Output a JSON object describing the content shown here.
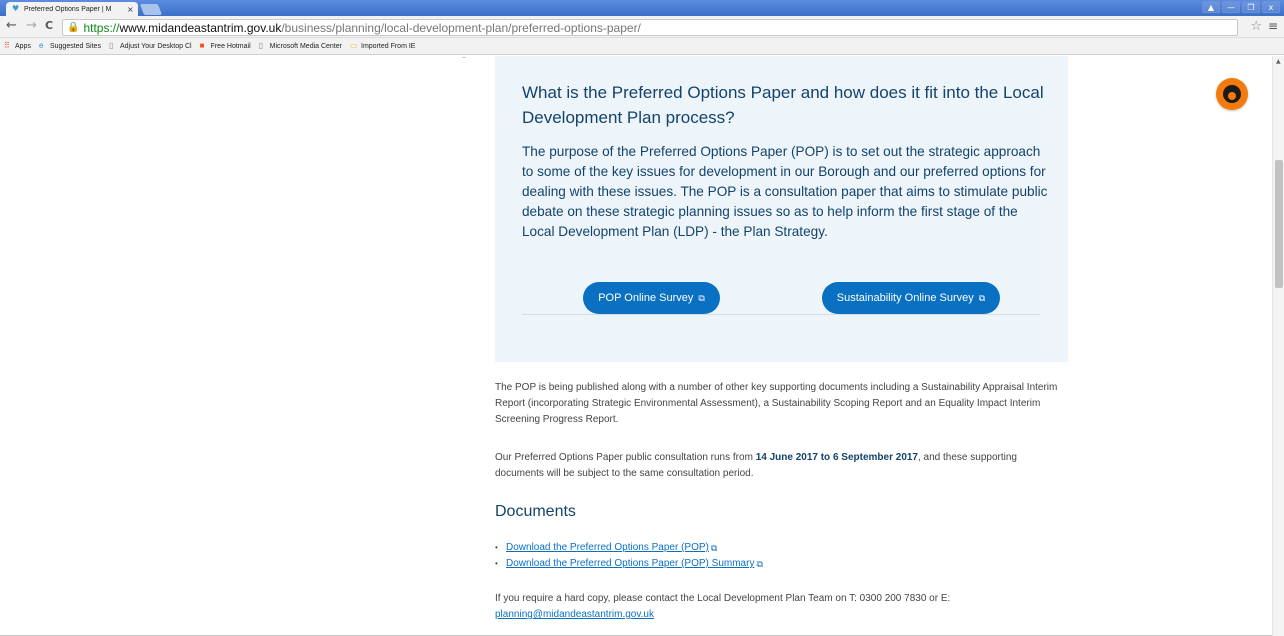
{
  "browser": {
    "tab_title": "Preferred Options Paper | M",
    "tab_close": "×",
    "window_controls": [
      "▲",
      "—",
      "❐",
      "x"
    ],
    "url_scheme": "https://",
    "url_host": "www.midandeastantrim.gov.uk",
    "url_path": "/business/planning/local-development-plan/preferred-options-paper/",
    "nav_back": "←",
    "nav_forward": "→",
    "nav_reload": "C",
    "star": "☆",
    "menu": "≡",
    "bookmarks": [
      {
        "label": "Apps",
        "icon": "apps-grid-icon"
      },
      {
        "label": "Suggested Sites",
        "icon": "ie-icon"
      },
      {
        "label": "Adjust Your Desktop Cl",
        "icon": "page-icon"
      },
      {
        "label": "Free Hotmail",
        "icon": "windows-icon"
      },
      {
        "label": "Microsoft Media Center",
        "icon": "page-icon"
      },
      {
        "label": "Imported From IE",
        "icon": "folder-icon"
      }
    ]
  },
  "callout": {
    "heading": "What is the Preferred Options Paper and how does it fit into the Local Development Plan process?",
    "body": "The purpose of the Preferred Options Paper (POP) is to set out the strategic approach to some of the key issues for development in our Borough and our preferred options for dealing with these issues.  The POP is a consultation paper that aims to stimulate public debate on these strategic planning issues so as to help inform the first stage of the Local Development Plan (LDP) - the Plan Strategy.",
    "buttons": {
      "pop_survey": "POP Online Survey",
      "sustainability_survey": "Sustainability Online Survey"
    }
  },
  "content": {
    "para1": "The POP is being published along with a number of other key supporting documents including a Sustainability Appraisal Interim Report (incorporating Strategic Environmental Assessment), a Sustainability Scoping Report and an Equality Impact Interim Screening Progress Report.",
    "para2_pre": "Our Preferred Options Paper public consultation runs from ",
    "para2_bold": "14 June 2017 to 6 September 2017",
    "para2_post": ", and these supporting documents will be subject to the same consultation period.",
    "documents_heading": "Documents",
    "documents": [
      "Download the Preferred Options Paper (POP)",
      "Download the Preferred Options Paper (POP) Summary"
    ],
    "para3": "If you require a hard copy, please contact the Local Development Plan Team on T: 0300 200 7830 or E:",
    "email": "planning@midandeastantrim.gov.uk"
  },
  "colors": {
    "accent_blue": "#0a70c2",
    "heading_navy": "#13436b",
    "callout_bg": "#eef5fa",
    "accessibility_orange": "#f47b0b"
  }
}
